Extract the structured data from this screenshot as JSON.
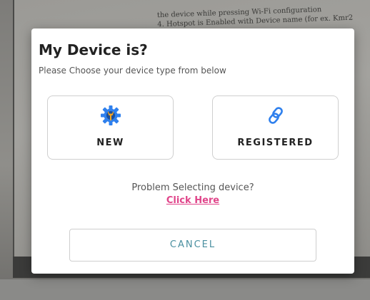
{
  "background": {
    "paper_lines": [
      "4. Hotspot is Enabled with Device name (for ex. Kmr2",
      "   the device while pressing Wi-Fi configuration"
    ]
  },
  "dialog": {
    "title": "My Device is?",
    "subtitle": "Please Choose your device type from below",
    "options": [
      {
        "label": "NEW",
        "icon": "gear-wrench-icon",
        "icon_color": "#2f80ed",
        "icon_accent": "#f5a623"
      },
      {
        "label": "REGISTERED",
        "icon": "link-icon",
        "icon_color": "#2f80ed"
      }
    ],
    "problem_text": "Problem Selecting device?",
    "click_here_label": "Click Here",
    "cancel_label": "CANCEL",
    "colors": {
      "link": "#e0458a",
      "cancel_text": "#4a8fa0"
    }
  }
}
